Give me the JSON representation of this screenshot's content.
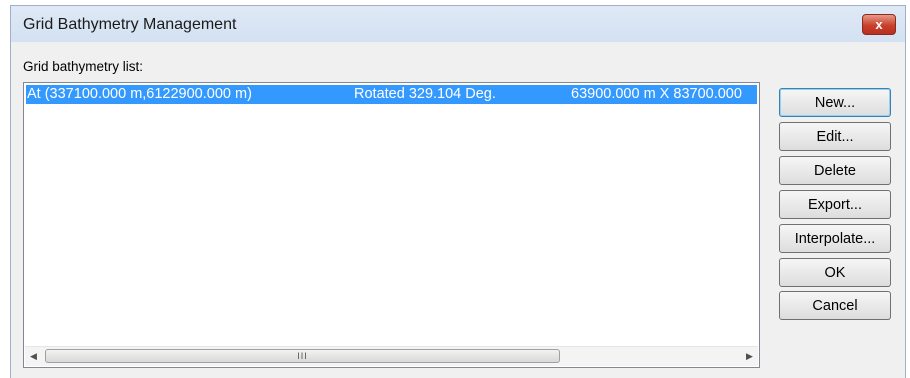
{
  "window": {
    "title": "Grid Bathymetry Management",
    "close_label": "x"
  },
  "list": {
    "label": "Grid bathymetry list:",
    "items": [
      {
        "origin": "At (337100.000 m,6122900.000 m)",
        "rotation": "Rotated 329.104 Deg.",
        "size": "63900.000 m X 83700.000",
        "selected": true
      }
    ],
    "scrollbar": {
      "thumb_grip": "III"
    }
  },
  "buttons": {
    "new": "New...",
    "edit": "Edit...",
    "delete": "Delete",
    "export": "Export...",
    "interpolate": "Interpolate...",
    "ok": "OK",
    "cancel": "Cancel"
  },
  "colors": {
    "selection": "#3399ff",
    "close": "#c8412c"
  }
}
